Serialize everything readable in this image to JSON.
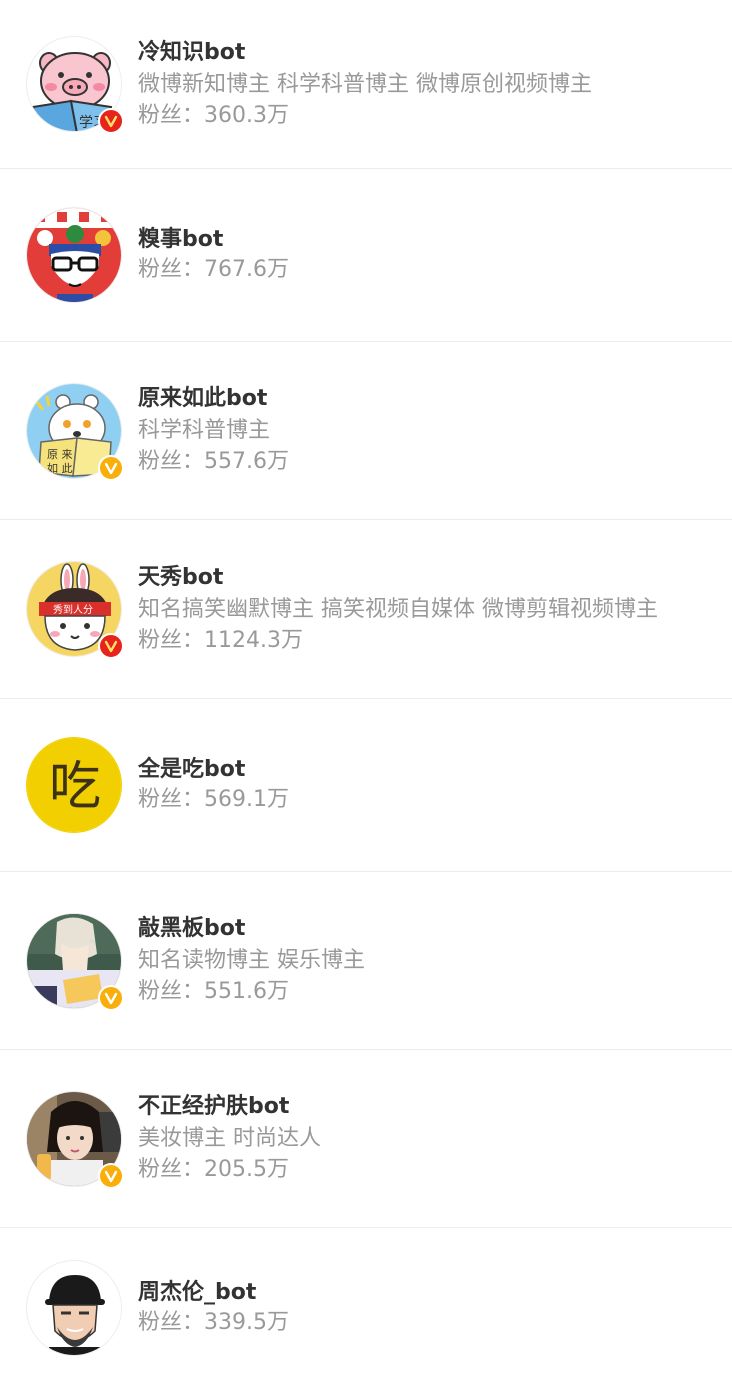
{
  "colors": {
    "verified_red": "#e7231b",
    "verified_gold": "#f9ae0a",
    "name": "#333333",
    "meta": "#999999",
    "divider": "#ededed"
  },
  "fans_prefix": "粉丝：",
  "accounts": [
    {
      "name": "冷知识bot",
      "description": "微博新知博主 科学科普博主 微博原创视频博主",
      "fans": "360.3万",
      "avatar_icon": "pig-reading-avatar",
      "badge": "verified-red-icon"
    },
    {
      "name": "糗事bot",
      "description": "",
      "fans": "767.6万",
      "avatar_icon": "glasses-cartoon-avatar",
      "badge": ""
    },
    {
      "name": "原来如此bot",
      "description": "科学科普博主",
      "fans": "557.6万",
      "avatar_icon": "polar-bear-avatar",
      "badge": "verified-gold-icon",
      "avatar_text": "原来如此"
    },
    {
      "name": "天秀bot",
      "description": "知名搞笑幽默博主 搞笑视频自媒体 微博剪辑视频博主",
      "fans": "1124.3万",
      "avatar_icon": "bunny-ears-cartoon-avatar",
      "badge": "verified-red-icon",
      "avatar_text": "秀到人分"
    },
    {
      "name": "全是吃bot",
      "description": "",
      "fans": "569.1万",
      "avatar_icon": "yellow-chi-avatar",
      "badge": "",
      "avatar_text": "吃"
    },
    {
      "name": "敲黑板bot",
      "description": "知名读物博主 娱乐博主",
      "fans": "551.6万",
      "avatar_icon": "anime-student-avatar",
      "badge": "verified-gold-icon"
    },
    {
      "name": "不正经护肤bot",
      "description": "美妆博主 时尚达人",
      "fans": "205.5万",
      "avatar_icon": "girl-photo-avatar",
      "badge": "verified-gold-icon"
    },
    {
      "name": "周杰伦_bot",
      "description": "",
      "fans": "339.5万",
      "avatar_icon": "cap-man-cartoon-avatar",
      "badge": ""
    }
  ]
}
